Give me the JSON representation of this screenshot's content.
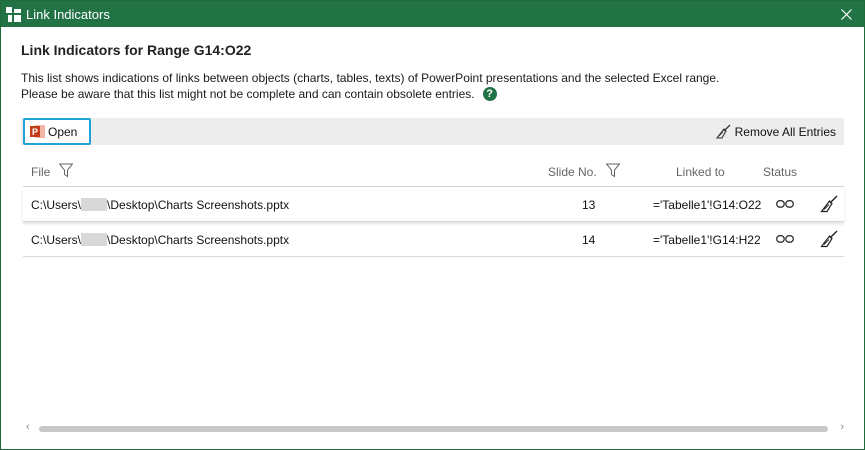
{
  "window": {
    "title": "Link Indicators"
  },
  "heading": "Link Indicators for Range G14:O22",
  "description": {
    "line1": "This list shows indications of links between objects (charts, tables, texts) of PowerPoint presentations and the selected Excel range.",
    "line2": "Please be aware that this list might not be complete and can contain obsolete entries."
  },
  "toolbar": {
    "open_label": "Open",
    "remove_all_label": "Remove All Entries"
  },
  "table": {
    "columns": {
      "file": "File",
      "slide": "Slide No.",
      "linked": "Linked to",
      "status": "Status"
    },
    "rows": [
      {
        "path_prefix": "C:\\Users\\",
        "path_suffix": "\\Desktop\\Charts Screenshots.pptx",
        "slide": "13",
        "linked": "='Tabelle1'!G14:O22"
      },
      {
        "path_prefix": "C:\\Users\\",
        "path_suffix": "\\Desktop\\Charts Screenshots.pptx",
        "slide": "14",
        "linked": "='Tabelle1'!G14:H22"
      }
    ]
  },
  "scrollbar": {
    "left_arrow": "‹",
    "right_arrow": "›"
  },
  "icons": [
    "app-icon",
    "close-icon",
    "help-icon",
    "powerpoint-icon",
    "broom-icon",
    "filter-icon",
    "link-icon"
  ],
  "colors": {
    "title_bar": "#217346",
    "open_highlight": "#1fa3d9",
    "toolbar_bg": "#ededed"
  }
}
